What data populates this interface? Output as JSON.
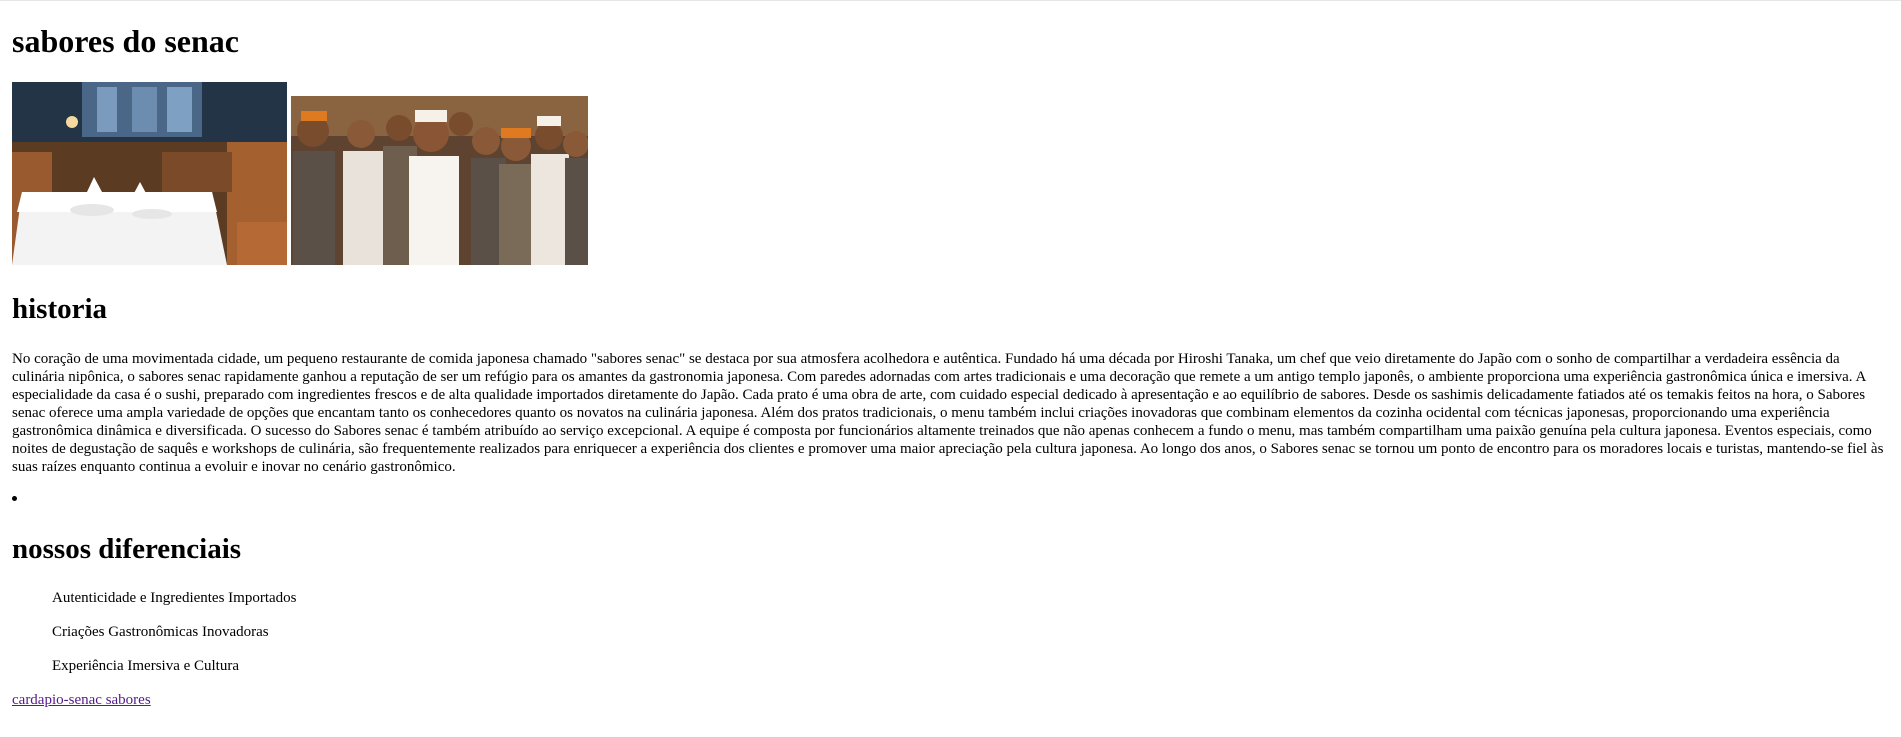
{
  "header": {
    "title": "sabores do senac"
  },
  "gallery": {
    "images": [
      {
        "icon": "restaurant-dining-room-image"
      },
      {
        "icon": "chef-team-photo-image"
      }
    ]
  },
  "historia": {
    "heading": "historia",
    "text": "No coração de uma movimentada cidade, um pequeno restaurante de comida japonesa chamado \"sabores senac\" se destaca por sua atmosfera acolhedora e autêntica. Fundado há uma década por Hiroshi Tanaka, um chef que veio diretamente do Japão com o sonho de compartilhar a verdadeira essência da culinária nipônica, o sabores senac rapidamente ganhou a reputação de ser um refúgio para os amantes da gastronomia japonesa. Com paredes adornadas com artes tradicionais e uma decoração que remete a um antigo templo japonês, o ambiente proporciona uma experiência gastronômica única e imersiva. A especialidade da casa é o sushi, preparado com ingredientes frescos e de alta qualidade importados diretamente do Japão. Cada prato é uma obra de arte, com cuidado especial dedicado à apresentação e ao equilíbrio de sabores. Desde os sashimis delicadamente fatiados até os temakis feitos na hora, o Sabores senac oferece uma ampla variedade de opções que encantam tanto os conhecedores quanto os novatos na culinária japonesa. Além dos pratos tradicionais, o menu também inclui criações inovadoras que combinam elementos da cozinha ocidental com técnicas japonesas, proporcionando uma experiência gastronômica dinâmica e diversificada. O sucesso do Sabores senac é também atribuído ao serviço excepcional. A equipe é composta por funcionários altamente treinados que não apenas conhecem a fundo o menu, mas também compartilham uma paixão genuína pela cultura japonesa. Eventos especiais, como noites de degustação de saquês e workshops de culinária, são frequentemente realizados para enriquecer a experiência dos clientes e promover uma maior apreciação pela cultura japonesa. Ao longo dos anos, o Sabores senac se tornou um ponto de encontro para os moradores locais e turistas, mantendo-se fiel às suas raízes enquanto continua a evoluir e inovar no cenário gastronômico."
  },
  "diferenciais": {
    "heading": "nossos diferenciais",
    "items": [
      "Autenticidade e Ingredientes Importados",
      "Criações Gastronômicas Inovadoras",
      "Experiência Imersiva e Cultura"
    ]
  },
  "footer": {
    "link_label": "cardapio-senac sabores",
    "link_color": "#551a8b"
  }
}
